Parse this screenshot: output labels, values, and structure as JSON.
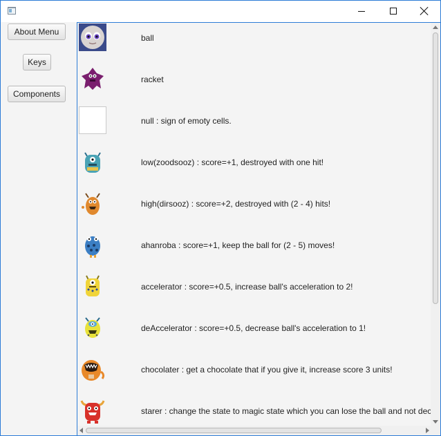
{
  "window": {
    "title": "",
    "controls": [
      "minimize",
      "maximize",
      "close"
    ],
    "accent": "#2b7bd6"
  },
  "sidebar": {
    "about_label": "About Menu",
    "keys_label": "Keys",
    "components_label": "Components"
  },
  "components": [
    {
      "icon": "ball-monster-icon",
      "text": "ball"
    },
    {
      "icon": "racket-monster-icon",
      "text": "racket"
    },
    {
      "icon": "empty-cell-icon",
      "text": "null : sign of emoty cells."
    },
    {
      "icon": "zoodsooz-monster-icon",
      "text": "low(zoodsooz) : score=+1, destroyed with one hit!"
    },
    {
      "icon": "dirsooz-monster-icon",
      "text": "high(dirsooz) : score=+2, destroyed with (2 - 4) hits!"
    },
    {
      "icon": "ahanroba-monster-icon",
      "text": "ahanroba : score=+1, keep the ball for (2 - 5) moves!"
    },
    {
      "icon": "accelerator-monster-icon",
      "text": "accelerator : score=+0.5, increase ball's acceleration to 2!"
    },
    {
      "icon": "deaccelerator-monster-icon",
      "text": "deAccelerator : score=+0.5, decrease ball's acceleration to 1!"
    },
    {
      "icon": "chocolater-monster-icon",
      "text": "chocolater : get a chocolate that if you give it, increase score 3 units!"
    },
    {
      "icon": "starer-monster-icon",
      "text": "starer : change the state to magic state which you can lose the ball and not decr"
    }
  ]
}
